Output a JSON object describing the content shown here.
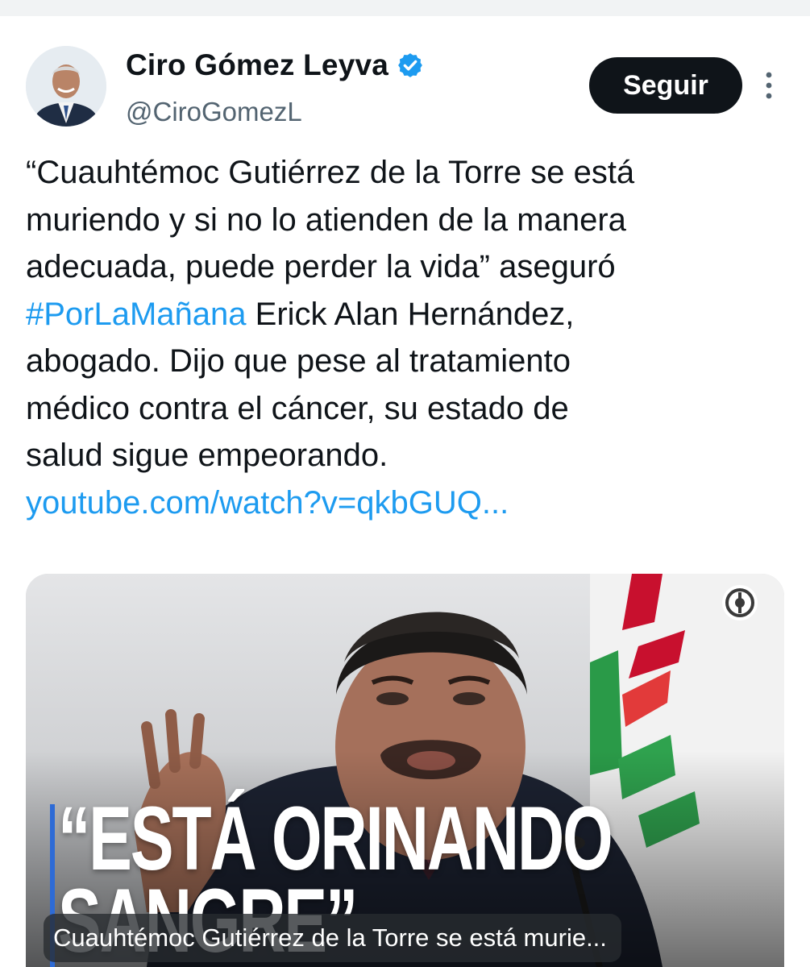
{
  "author": {
    "display_name": "Ciro Gómez Leyva",
    "handle": "@CiroGomezL",
    "verified_icon": "verified-badge-icon",
    "avatar_icon": "avatar"
  },
  "follow_label": "Seguir",
  "more_icon": "more-vertical-icon",
  "tweet": {
    "line1": "“Cuauhtémoc Gutiérrez de la Torre se está",
    "line2": "muriendo y si no lo atienden de la manera",
    "line3": "adecuada, puede perder la vida” aseguró",
    "hashtag": "#PorLaMañana",
    "line4_rest": " Erick Alan Hernández,",
    "line5": "abogado. Dijo que pese al tratamiento",
    "line6": "médico contra el cáncer, su estado de",
    "line7": "salud sigue empeorando.",
    "link": "youtube.com/watch?v=qkbGUQ..."
  },
  "media": {
    "headline_line1": "“ESTÁ ORINANDO",
    "headline_line2": "SANGRE”",
    "caption": "Cuauhtémoc Gutiérrez de la Torre se está murie...",
    "brand_icon": "imagen-logo-icon"
  },
  "colors": {
    "link": "#1d9bf0",
    "verified": "#1d9bf0",
    "follow_bg": "#0f1419",
    "text": "#0f1419",
    "secondary": "#536471"
  }
}
